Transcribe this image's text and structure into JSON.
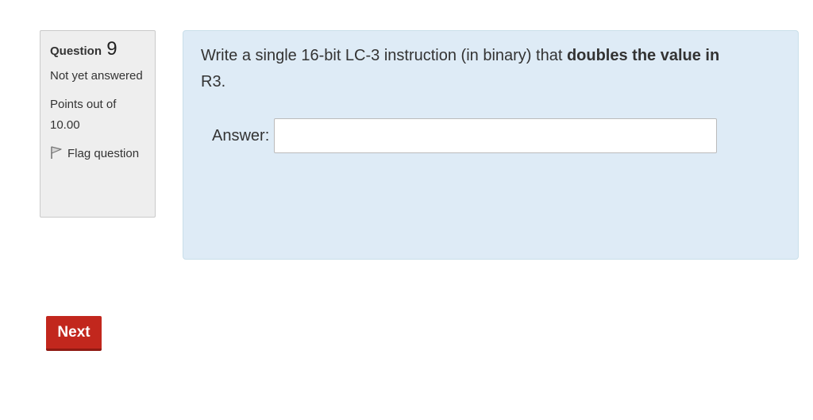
{
  "question_info": {
    "label": "Question",
    "number": "9",
    "state": "Not yet answered",
    "grade": "Points out of 10.00",
    "flag_label": "Flag question"
  },
  "question": {
    "text_plain": "Write a single 16-bit LC-3 instruction (in binary) that ",
    "text_bold": "doubles the value in",
    "text_tail": "R3.",
    "answer_label": "Answer:",
    "answer_value": ""
  },
  "navigation": {
    "next_label": "Next"
  },
  "colors": {
    "info_bg": "#eeeeee",
    "content_bg": "#deebf6",
    "next_button": "#c2271d"
  }
}
